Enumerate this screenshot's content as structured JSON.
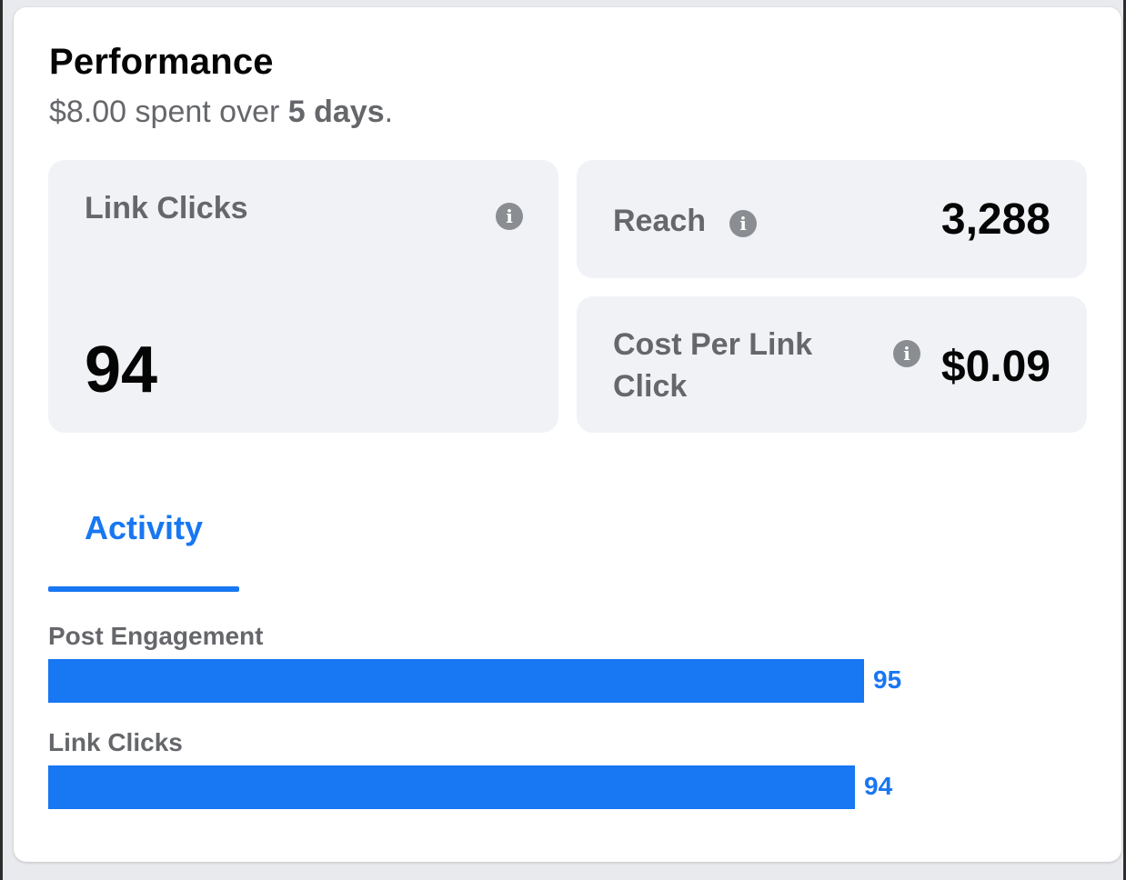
{
  "performance": {
    "title": "Performance",
    "spend_amount": "$8.00",
    "spend_middle": " spent over ",
    "spend_days": "5 days",
    "spend_end": "."
  },
  "metrics": {
    "link_clicks": {
      "label": "Link Clicks",
      "value": "94",
      "icon": "info-icon"
    },
    "reach": {
      "label": "Reach",
      "value": "3,288",
      "icon": "info-icon"
    },
    "cost_per_link_click": {
      "label_line1": "Cost Per Link",
      "label_line2": "Click",
      "value": "$0.09",
      "icon": "info-icon"
    }
  },
  "tabs": [
    {
      "label": "Activity",
      "selected": true
    }
  ],
  "activity": {
    "max": 100,
    "rows": [
      {
        "label": "Post Engagement",
        "value": 95,
        "value_text": "95"
      },
      {
        "label": "Link Clicks",
        "value": 94,
        "value_text": "94"
      }
    ]
  },
  "colors": {
    "accent": "#1877f2",
    "tile_bg": "#f0f2f5",
    "muted_text": "#65676b",
    "primary_text": "#050505"
  }
}
